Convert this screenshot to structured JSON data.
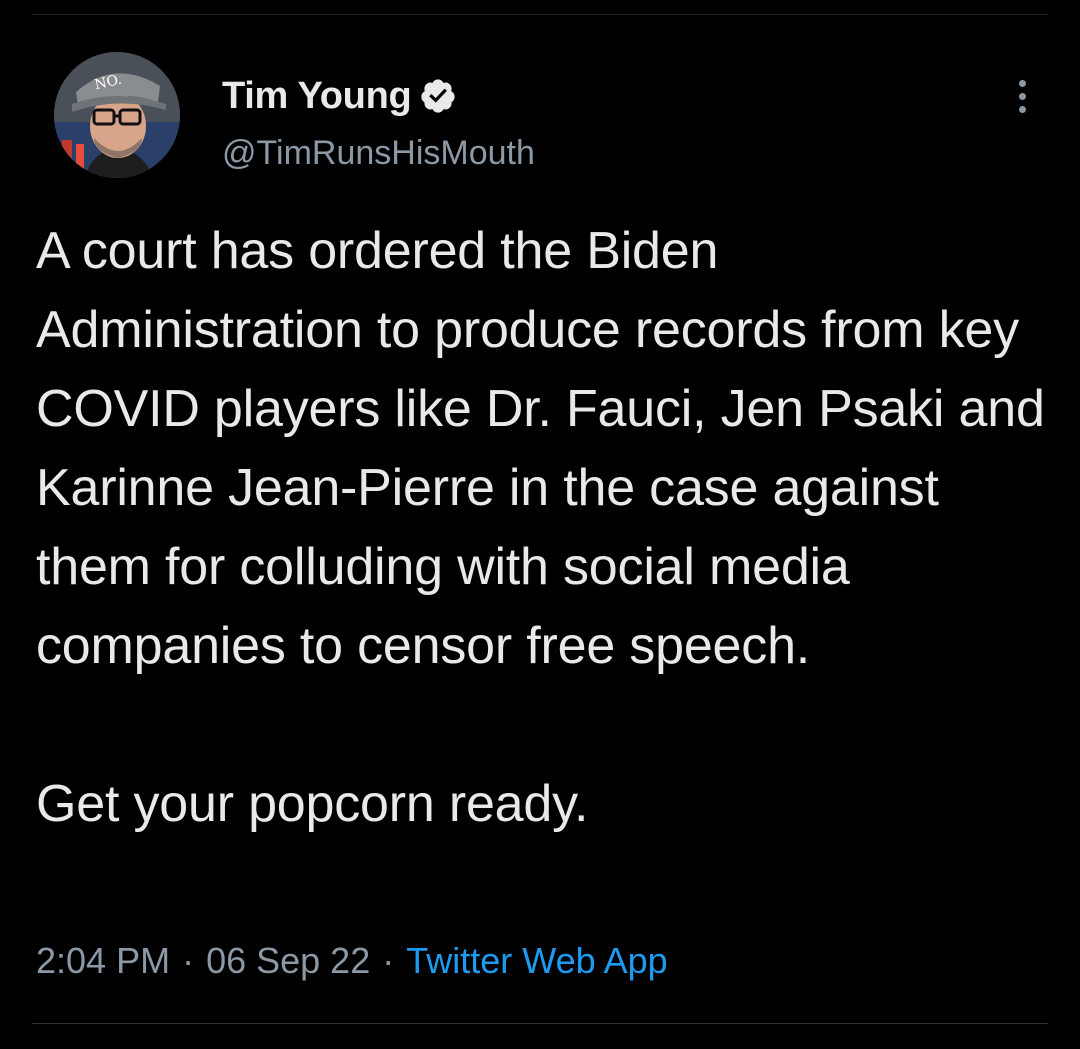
{
  "author": {
    "display_name": "Tim Young",
    "handle": "@TimRunsHisMouth",
    "verified": true,
    "avatar_cap_text": "NO."
  },
  "icons": {
    "verified": "verified-badge-icon",
    "more": "more-options-icon"
  },
  "tweet": {
    "paragraph_1": "A court has ordered the Biden Administration to produce records from key COVID players like Dr. Fauci, Jen Psaki and Karinne Jean-Pierre in the case against them for colluding with social media companies to censor free speech.",
    "paragraph_2": "Get your popcorn ready."
  },
  "meta": {
    "time": "2:04 PM",
    "separator": "·",
    "date": "06 Sep 22",
    "source": "Twitter Web App"
  },
  "colors": {
    "background": "#000000",
    "text": "#e7e9ea",
    "secondary": "#8b98a5",
    "link": "#1d9bf0"
  }
}
